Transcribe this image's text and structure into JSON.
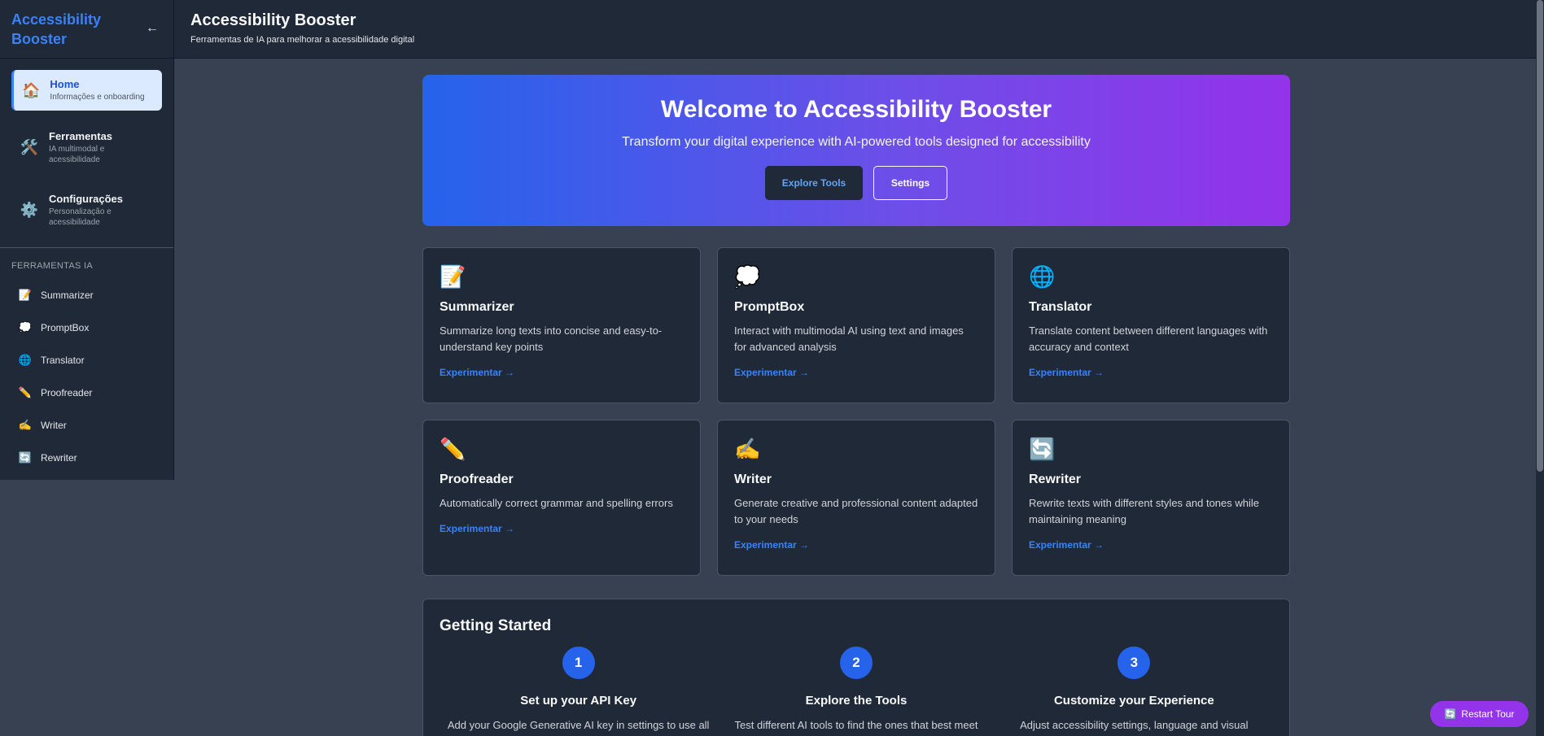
{
  "sidebar": {
    "brand": "Accessibility Booster",
    "collapse_icon": "←",
    "nav": [
      {
        "icon": "🏠",
        "title": "Home",
        "subtitle": "Informações e onboarding"
      },
      {
        "icon": "🛠️",
        "title": "Ferramentas",
        "subtitle": "IA multimodal e acessibilidade"
      },
      {
        "icon": "⚙️",
        "title": "Configurações",
        "subtitle": "Personalização e acessibilidade"
      }
    ],
    "section_label": "FERRAMENTAS IA",
    "tools": [
      {
        "icon": "📝",
        "label": "Summarizer"
      },
      {
        "icon": "💭",
        "label": "PromptBox"
      },
      {
        "icon": "🌐",
        "label": "Translator"
      },
      {
        "icon": "✏️",
        "label": "Proofreader"
      },
      {
        "icon": "✍️",
        "label": "Writer"
      },
      {
        "icon": "🔄",
        "label": "Rewriter"
      }
    ]
  },
  "header": {
    "title": "Accessibility Booster",
    "subtitle": "Ferramentas de IA para melhorar a acessibilidade digital"
  },
  "hero": {
    "title": "Welcome to Accessibility Booster",
    "subtitle": "Transform your digital experience with AI-powered tools designed for accessibility",
    "primary_button": "Explore Tools",
    "secondary_button": "Settings"
  },
  "cards": [
    {
      "icon": "📝",
      "title": "Summarizer",
      "desc": "Summarize long texts into concise and easy-to-understand key points",
      "link": "Experimentar →"
    },
    {
      "icon": "💭",
      "title": "PromptBox",
      "desc": "Interact with multimodal AI using text and images for advanced analysis",
      "link": "Experimentar →"
    },
    {
      "icon": "🌐",
      "title": "Translator",
      "desc": "Translate content between different languages with accuracy and context",
      "link": "Experimentar →"
    },
    {
      "icon": "✏️",
      "title": "Proofreader",
      "desc": "Automatically correct grammar and spelling errors",
      "link": "Experimentar →"
    },
    {
      "icon": "✍️",
      "title": "Writer",
      "desc": "Generate creative and professional content adapted to your needs",
      "link": "Experimentar →"
    },
    {
      "icon": "🔄",
      "title": "Rewriter",
      "desc": "Rewrite texts with different styles and tones while maintaining meaning",
      "link": "Experimentar →"
    }
  ],
  "getting_started": {
    "title": "Getting Started",
    "steps": [
      {
        "num": "1",
        "title": "Set up your API Key",
        "desc": "Add your Google Generative AI key in settings to use all"
      },
      {
        "num": "2",
        "title": "Explore the Tools",
        "desc": "Test different AI tools to find the ones that best meet"
      },
      {
        "num": "3",
        "title": "Customize your Experience",
        "desc": "Adjust accessibility settings, language and visual"
      }
    ]
  },
  "restart_tour": {
    "icon": "🔄",
    "label": "Restart Tour"
  },
  "colors": {
    "accent": "#3b82f6",
    "hero_start": "#2563eb",
    "hero_end": "#9333ea",
    "restart_bg": "#9333ea"
  }
}
